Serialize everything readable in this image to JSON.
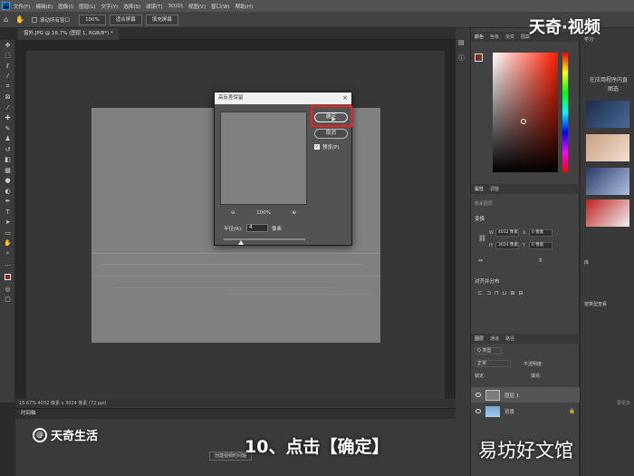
{
  "menubar": {
    "logo": "Ps",
    "items": [
      "文件(F)",
      "编辑(E)",
      "图像(I)",
      "图层(L)",
      "文字(Y)",
      "选择(S)",
      "滤镜(T)",
      "3D(D)",
      "视图(V)",
      "窗口(W)",
      "帮助(H)"
    ]
  },
  "options": {
    "scroll_all": "滚动所有窗口",
    "zoom": "100%",
    "fit_screen": "适合屏幕",
    "fill_screen": "填充屏幕"
  },
  "document": {
    "tab_title": "窗外.JPG @ 16.7% (图层 1, RGB/8*) *",
    "status": "16.67%    4032 像素 x 3024 像素 (72 ppi)"
  },
  "timeline": {
    "title": "时间轴",
    "create_button": "创建视频时间轴"
  },
  "dialog": {
    "title": "高反差保留",
    "ok": "确定",
    "cancel": "取消",
    "preview_label": "预览(P)",
    "preview_checked": true,
    "zoom": "100%",
    "zoom_out": "⊖",
    "zoom_in": "⊕",
    "radius_label": "半径(R):",
    "radius_value": "4",
    "radius_unit": "像素"
  },
  "right_panel": {
    "tabs_top": [
      "颜色",
      "色板",
      "渐变",
      "图案"
    ],
    "props_tabs": [
      "属性",
      "调整"
    ],
    "props_subtitle": "像素图层",
    "transform": {
      "title": "变换",
      "w_label": "W",
      "w": "4032 像素",
      "h_label": "H",
      "h": "3024 像素",
      "x_label": "X",
      "x": "0 像素",
      "y_label": "Y",
      "y": "0 像素"
    },
    "align_title": "对齐并分布",
    "layers_tabs": [
      "图层",
      "通道",
      "路径"
    ],
    "kind": "Q 类型",
    "blend": "正常",
    "opacity": "不透明度:",
    "lock": "锁定:",
    "fill": "填充:",
    "layers": [
      {
        "name": "图层 1"
      },
      {
        "name": "背景"
      }
    ]
  },
  "learn_panel": {
    "tab": "学习",
    "text1": "在应用程序内直",
    "text2": "图选",
    "lib_tab": "库",
    "lib_text": "按类型查看",
    "more": "要更多"
  },
  "overlay": {
    "brand_top": "天奇·视频",
    "brand_left": "天奇生活",
    "brand_left_badge": "@",
    "caption": "10、点击【确定】",
    "brand_right": "易坊好文馆"
  },
  "colors": {
    "highlight": "#ff1c1c",
    "foreground": "#7a2e23"
  },
  "icons": [
    "move-icon",
    "marquee-icon",
    "lasso-icon",
    "magic-wand-icon",
    "crop-icon",
    "frame-icon",
    "eyedropper-icon",
    "healing-icon",
    "brush-icon",
    "stamp-icon",
    "history-brush-icon",
    "eraser-icon",
    "gradient-icon",
    "blur-icon",
    "dodge-icon",
    "pen-icon",
    "text-icon",
    "path-select-icon",
    "rectangle-icon",
    "hand-icon",
    "zoom-icon"
  ]
}
